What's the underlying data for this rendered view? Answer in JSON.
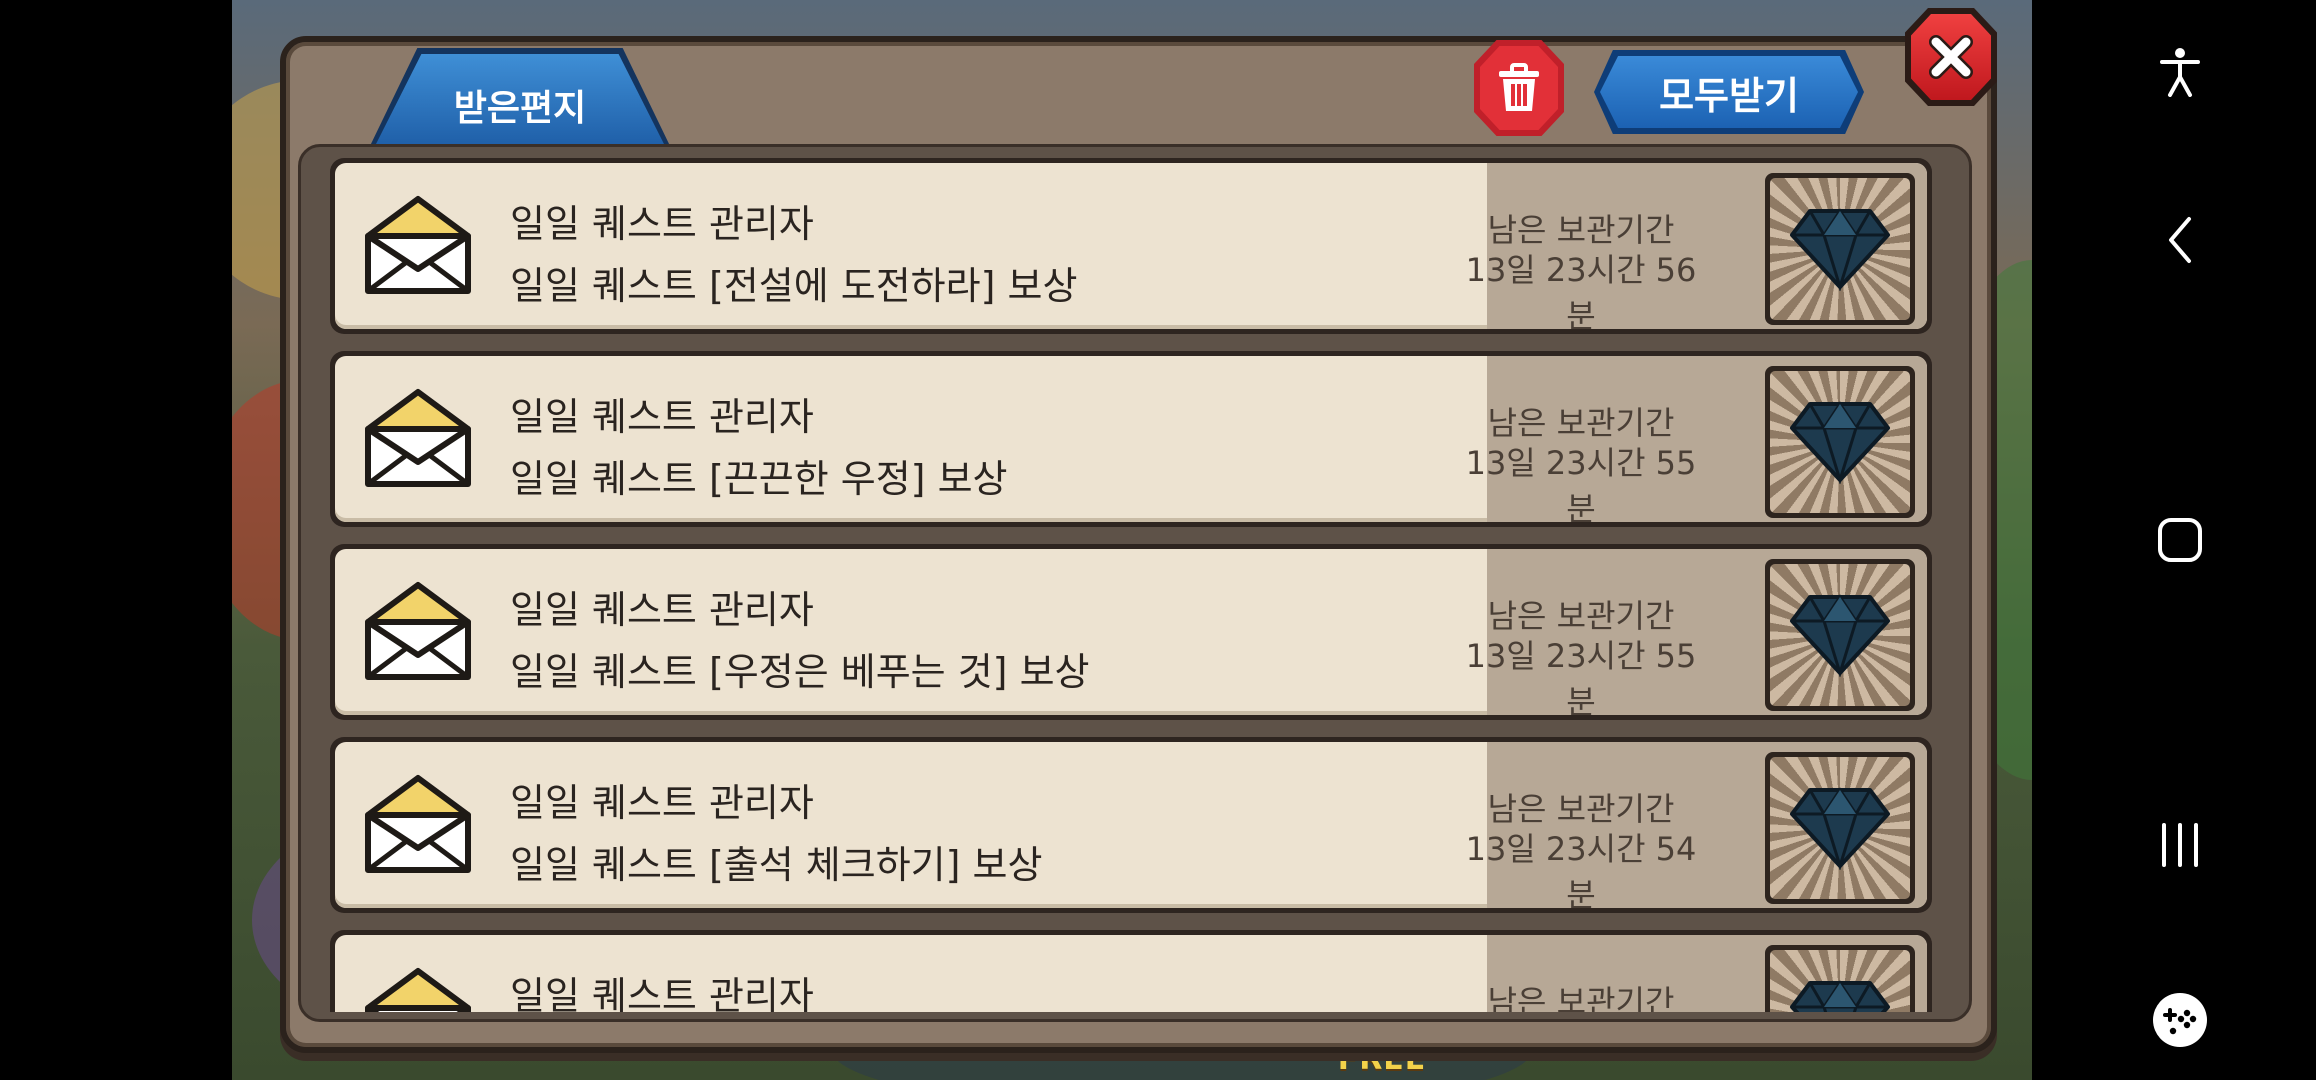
{
  "dialog": {
    "tab_label": "받은편지",
    "receive_all_label": "모두받기"
  },
  "colors": {
    "tab_blue": "#2f7cc8",
    "close_red": "#e02a30",
    "mail_bg": "#ede3d1",
    "reward_side_bg": "#b7a896"
  },
  "mails": [
    {
      "sender": "일일 퀘스트 관리자",
      "subject": "일일 퀘스트 [전설에 도전하라] 보상",
      "remain_label": "남은 보관기간",
      "remain_value": "13일 23시간 56분",
      "reward_icon": "diamond-icon"
    },
    {
      "sender": "일일 퀘스트 관리자",
      "subject": "일일 퀘스트 [끈끈한 우정] 보상",
      "remain_label": "남은 보관기간",
      "remain_value": "13일 23시간 55분",
      "reward_icon": "diamond-icon"
    },
    {
      "sender": "일일 퀘스트 관리자",
      "subject": "일일 퀘스트 [우정은 베푸는 것] 보상",
      "remain_label": "남은 보관기간",
      "remain_value": "13일 23시간 55분",
      "reward_icon": "diamond-icon"
    },
    {
      "sender": "일일 퀘스트 관리자",
      "subject": "일일 퀘스트 [출석 체크하기] 보상",
      "remain_label": "남은 보관기간",
      "remain_value": "13일 23시간 54분",
      "reward_icon": "diamond-icon"
    },
    {
      "sender": "일일 퀘스트 관리자",
      "subject": "",
      "remain_label": "남은 보관기간",
      "remain_value": "",
      "reward_icon": "diamond-icon"
    }
  ],
  "background": {
    "free_label": "FREE"
  },
  "nav": {
    "icons": [
      "accessibility-icon",
      "back-icon",
      "home-icon",
      "recents-icon",
      "game-tools-icon"
    ]
  }
}
